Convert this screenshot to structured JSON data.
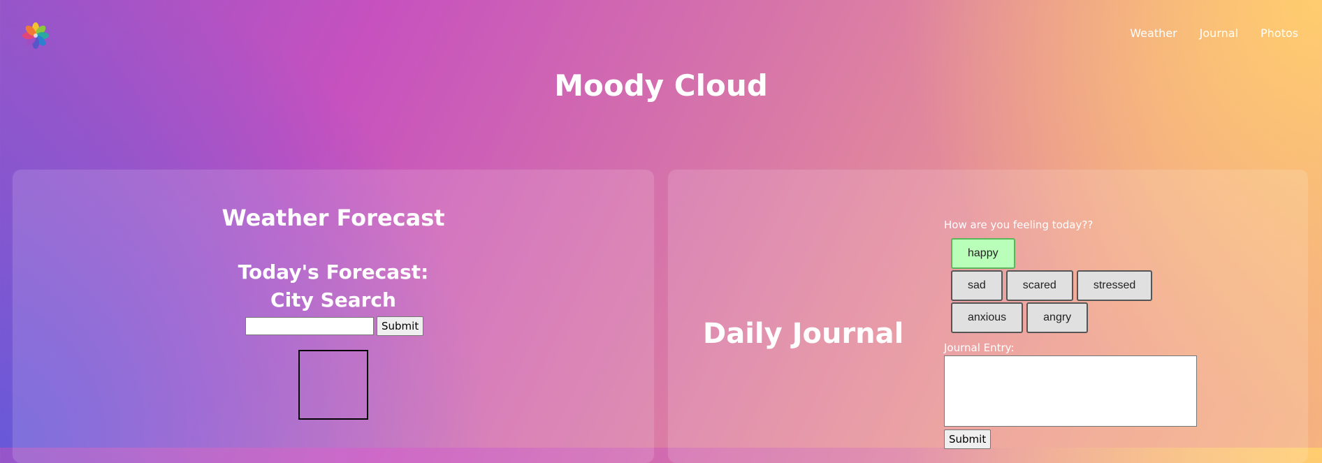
{
  "brand": {
    "logo_icon": "pinwheel-flower-logo"
  },
  "nav": [
    {
      "label": "Weather"
    },
    {
      "label": "Journal"
    },
    {
      "label": "Photos"
    }
  ],
  "site_title": "Moody Cloud",
  "weather": {
    "title": "Weather Forecast",
    "todays_forecast": "Today's Forecast:",
    "city_search": "City Search",
    "city_input": {
      "value": "",
      "placeholder": ""
    },
    "submit_label": "Submit"
  },
  "journal": {
    "title": "Daily Journal",
    "feeling_prompt": "How are you feeling today??",
    "moods": [
      {
        "label": "happy",
        "selected": true
      },
      {
        "label": "sad",
        "selected": false
      },
      {
        "label": "scared",
        "selected": false
      },
      {
        "label": "stressed",
        "selected": false
      },
      {
        "label": "anxious",
        "selected": false
      },
      {
        "label": "angry",
        "selected": false
      }
    ],
    "entry_label": "Journal Entry:",
    "entry_value": "",
    "submit_label": "Submit"
  },
  "colors": {
    "selected_mood_bg": "#b9ffb9",
    "mood_bg": "#e0e0e0"
  }
}
